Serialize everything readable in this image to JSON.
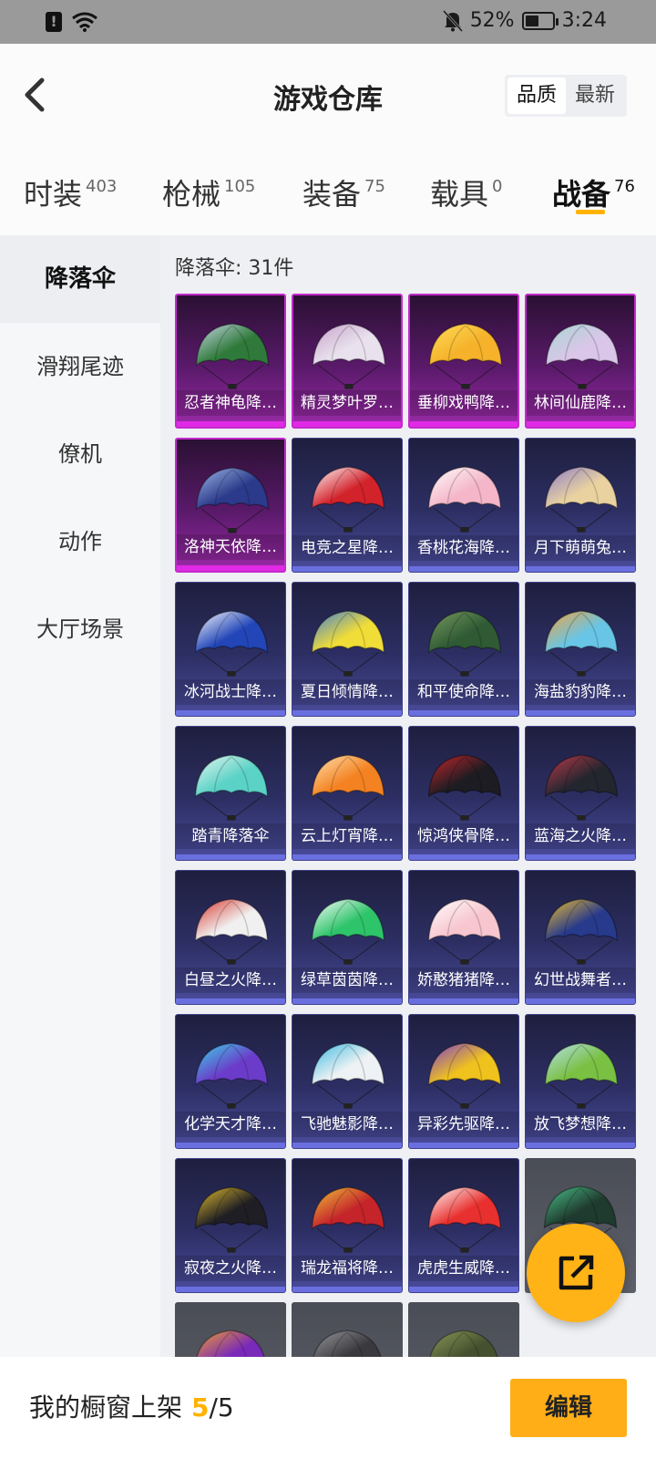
{
  "status_bar": {
    "battery": "52%",
    "battery_level": 0.52,
    "time": "3:24",
    "icons": [
      "alert-icon",
      "wifi-icon",
      "mute-bell-icon",
      "battery-icon"
    ]
  },
  "header": {
    "title": "游戏仓库",
    "sort_options": [
      "品质",
      "最新"
    ],
    "sort_selected": "品质"
  },
  "tabs": [
    {
      "label": "时装",
      "count": "403"
    },
    {
      "label": "枪械",
      "count": "105"
    },
    {
      "label": "装备",
      "count": "75"
    },
    {
      "label": "载具",
      "count": "0"
    },
    {
      "label": "战备",
      "count": "76",
      "active": true
    }
  ],
  "sidebar": {
    "items": [
      {
        "label": "降落伞",
        "active": true
      },
      {
        "label": "滑翔尾迹"
      },
      {
        "label": "僚机"
      },
      {
        "label": "动作"
      },
      {
        "label": "大厅场景"
      }
    ]
  },
  "content": {
    "count_text": "降落伞: 31件",
    "items": [
      {
        "name": "忍者神龟降…",
        "rarity": "legendary",
        "colors": [
          "#2f7a3a",
          "#c9d8e8"
        ]
      },
      {
        "name": "精灵梦叶罗…",
        "rarity": "legendary",
        "colors": [
          "#e9e2ee",
          "#c6a2c9"
        ]
      },
      {
        "name": "垂柳戏鸭降…",
        "rarity": "legendary",
        "colors": [
          "#f5b22a",
          "#ffdc5a"
        ]
      },
      {
        "name": "林间仙鹿降…",
        "rarity": "legendary",
        "colors": [
          "#d9c6e8",
          "#a8d7d3"
        ]
      },
      {
        "name": "洛神天依降…",
        "rarity": "legendary",
        "colors": [
          "#2b3a8a",
          "#9fb8e8"
        ]
      },
      {
        "name": "电竞之星降…",
        "rarity": "epic",
        "colors": [
          "#d2222a",
          "#ffffff"
        ]
      },
      {
        "name": "香桃花海降…",
        "rarity": "epic",
        "colors": [
          "#f4b6c8",
          "#ffffff"
        ]
      },
      {
        "name": "月下萌萌兔…",
        "rarity": "epic",
        "colors": [
          "#e9d2a0",
          "#8b7bc8"
        ]
      },
      {
        "name": "冰河战士降…",
        "rarity": "epic",
        "colors": [
          "#2246b8",
          "#ffffff"
        ]
      },
      {
        "name": "夏日倾情降…",
        "rarity": "epic",
        "colors": [
          "#f1dd38",
          "#3d7ed8"
        ]
      },
      {
        "name": "和平使命降…",
        "rarity": "epic",
        "colors": [
          "#2f5a34",
          "#7a9c62"
        ]
      },
      {
        "name": "海盐豹豹降…",
        "rarity": "epic",
        "colors": [
          "#68c5e6",
          "#f3a23c"
        ]
      },
      {
        "name": "踏青降落伞",
        "rarity": "epic",
        "colors": [
          "#5ad2c6",
          "#e8f6f0"
        ]
      },
      {
        "name": "云上灯宵降…",
        "rarity": "epic",
        "colors": [
          "#f48222",
          "#ffe2b0"
        ]
      },
      {
        "name": "惊鸿侠骨降…",
        "rarity": "epic",
        "colors": [
          "#1c1c22",
          "#c8262c"
        ]
      },
      {
        "name": "蓝海之火降…",
        "rarity": "epic",
        "colors": [
          "#23262f",
          "#c03a4a"
        ]
      },
      {
        "name": "白昼之火降…",
        "rarity": "epic",
        "colors": [
          "#f0f0f0",
          "#d8342a"
        ]
      },
      {
        "name": "绿草茵茵降…",
        "rarity": "epic",
        "colors": [
          "#2ec46a",
          "#ffffff"
        ]
      },
      {
        "name": "娇憨猪猪降…",
        "rarity": "epic",
        "colors": [
          "#f7c6cf",
          "#ffffff"
        ]
      },
      {
        "name": "幻世战舞者…",
        "rarity": "epic",
        "colors": [
          "#273a8c",
          "#f2c12e"
        ]
      },
      {
        "name": "化学天才降…",
        "rarity": "epic",
        "colors": [
          "#6b3cc9",
          "#3ad7e8"
        ]
      },
      {
        "name": "飞驰魅影降…",
        "rarity": "epic",
        "colors": [
          "#eef2f4",
          "#36b8e0"
        ]
      },
      {
        "name": "异彩先驱降…",
        "rarity": "epic",
        "colors": [
          "#f0c21e",
          "#7a3bd1"
        ]
      },
      {
        "name": "放飞梦想降…",
        "rarity": "epic",
        "colors": [
          "#7ac043",
          "#b8e2f0"
        ]
      },
      {
        "name": "寂夜之火降…",
        "rarity": "epic",
        "colors": [
          "#1e1e24",
          "#e7c12e"
        ]
      },
      {
        "name": "瑞龙福将降…",
        "rarity": "epic",
        "colors": [
          "#c4242a",
          "#f1c43a"
        ]
      },
      {
        "name": "虎虎生威降…",
        "rarity": "epic",
        "colors": [
          "#e8302e",
          "#ffffff"
        ]
      },
      {
        "name": "",
        "rarity": "grey",
        "colors": [
          "#1f3a2e",
          "#4bc48a"
        ]
      },
      {
        "name": "",
        "rarity": "grey",
        "colors": [
          "#7a2ab8",
          "#f2a22a"
        ]
      },
      {
        "name": "",
        "rarity": "grey",
        "colors": [
          "#3a3a3e",
          "#9a9aa0"
        ]
      },
      {
        "name": "",
        "rarity": "grey",
        "colors": [
          "#45502e",
          "#8c9a5a"
        ]
      }
    ]
  },
  "fab": {
    "icon": "share-external-icon"
  },
  "bottom": {
    "showcase_label": "我的橱窗上架",
    "showcase_current": "5",
    "showcase_total": "/5",
    "edit_label": "编辑"
  },
  "colors": {
    "accent": "#ffb300",
    "legendary": "#c42acc",
    "epic": "#3f418a"
  }
}
